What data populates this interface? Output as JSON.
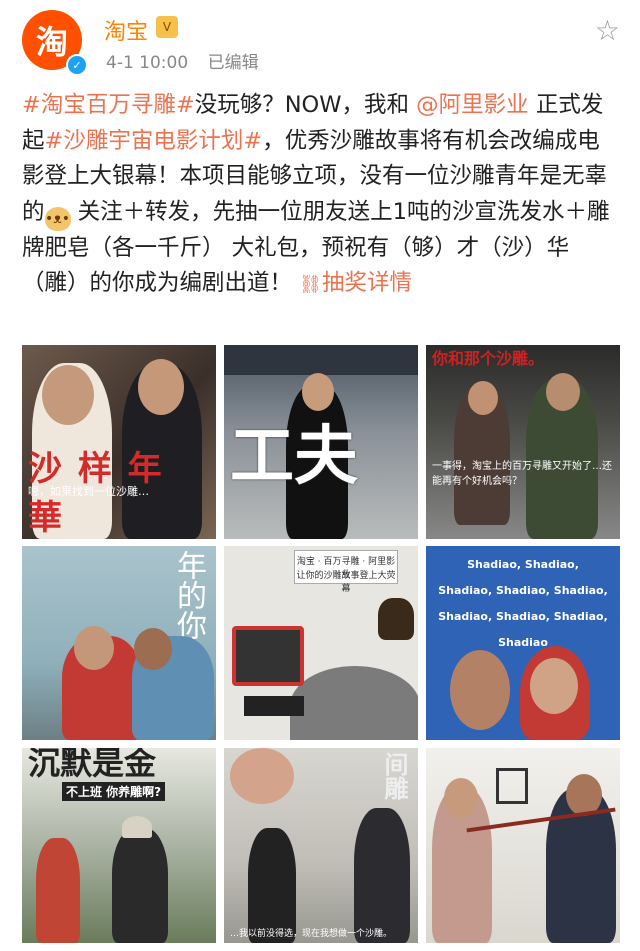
{
  "header": {
    "avatar_text": "淘",
    "name": "淘宝",
    "level_badge": "V",
    "verified_mark": "✓",
    "time": "4-1 10:00",
    "edited": "已编辑",
    "star_icon": "☆"
  },
  "post": {
    "hashtag1": "#淘宝百万寻雕#",
    "t1": "没玩够？NOW，我和",
    "mention": "@阿里影业",
    "t2": " 正式发起",
    "hashtag2": "#沙雕宇宙电影计划#",
    "t3": "，优秀沙雕故事将有机会改编成电影登上大银幕！本项目能够立项，没有一位沙雕青年是无辜的",
    "t4": " 关注＋转发，先抽一位朋友送上1吨的沙宣洗发水＋雕牌肥皂（各一千斤） 大礼包，预祝有（够）才（沙）华（雕）的你成为编剧出道！",
    "lottery_icon": "🔗",
    "lottery": "抽奖详情"
  },
  "images": {
    "img1_caption": "沙 样 年 華",
    "img1_sub": "嗯，如果找到一位沙雕…",
    "img2_caption": "工夫",
    "img3_caption": "你和那个沙雕。",
    "img3_sub": "一事得，淘宝上的百万寻雕又开始了…还能再有个好机会吗？",
    "img4_caption": "年的你",
    "img5_banner": "淘宝 · 百万寻雕 · 阿里影业",
    "img5_sub": "让你的沙雕故事登上大荧幕",
    "img6_lines": [
      "Shadiao, Shadiao,",
      "Shadiao, Shadiao, Shadiao,",
      "Shadiao, Shadiao, Shadiao, Shadiao"
    ],
    "img7_caption": "沉默是金",
    "img7_sub": "不上班 你养雕啊?",
    "img8_caption": "间雕",
    "img8_sub": "…我以前没得选，现在我想做一个沙雕。",
    "img9_caption": ""
  },
  "colors": {
    "link": "#eb7350",
    "brand": "#ff5000",
    "name": "#ff8200"
  }
}
